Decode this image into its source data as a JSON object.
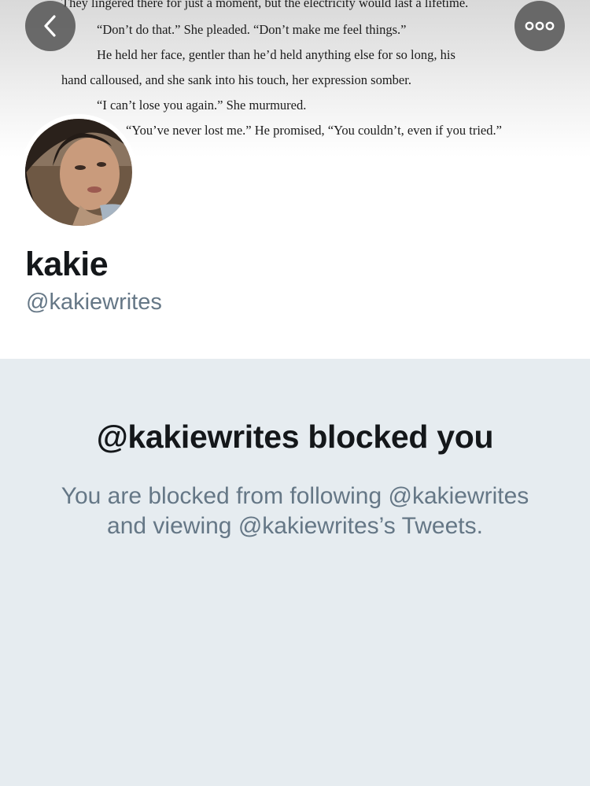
{
  "banner": {
    "lines": [
      "They lingered there for just a moment, but the electricity would last a lifetime.",
      "“Don’t do that.” She pleaded. “Don’t make me feel things.”",
      "He held her face, gentler than he’d held anything else for so long, his",
      "hand calloused, and she sank into his touch, her expression somber.",
      "“I can’t lose you again.” She murmured.",
      "“You’ve never lost me.” He promised, “You couldn’t, even if you tried.”"
    ]
  },
  "icons": {
    "back": "chevron-left-icon",
    "more": "more-horizontal-icon"
  },
  "profile": {
    "name": "kakie",
    "handle": "@kakiewrites"
  },
  "blocked": {
    "title": "@kakiewrites blocked you",
    "description": "You are blocked from following @kakiewrites and viewing @kakiewrites’s Tweets."
  },
  "colors": {
    "background": "#e6ecf0",
    "text_primary": "#14171a",
    "text_secondary": "#657786",
    "button_overlay": "#585858"
  }
}
